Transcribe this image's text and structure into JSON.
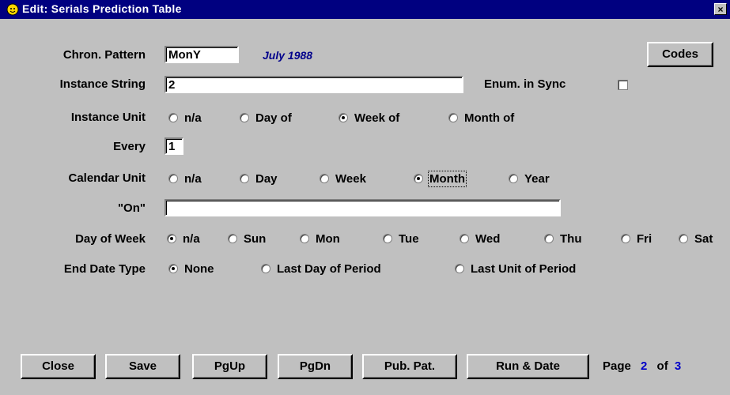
{
  "window": {
    "title": "Edit: Serials Prediction Table",
    "close_glyph": "×"
  },
  "fields": {
    "chron_pattern": {
      "label": "Chron. Pattern",
      "value": "MonY",
      "display": "July 1988"
    },
    "instance_string": {
      "label": "Instance String",
      "value": "2"
    },
    "enum_in_sync": {
      "label": "Enum. in Sync",
      "checked": false
    },
    "every": {
      "label": "Every",
      "value": "1"
    },
    "on": {
      "label": "\"On\"",
      "value": ""
    }
  },
  "instance_unit": {
    "label": "Instance Unit",
    "options": [
      "n/a",
      "Day of",
      "Week of",
      "Month of"
    ],
    "selected": "Week of"
  },
  "calendar_unit": {
    "label": "Calendar Unit",
    "options": [
      "n/a",
      "Day",
      "Week",
      "Month",
      "Year"
    ],
    "selected": "Month"
  },
  "day_of_week": {
    "label": "Day of Week",
    "options": [
      "n/a",
      "Sun",
      "Mon",
      "Tue",
      "Wed",
      "Thu",
      "Fri",
      "Sat"
    ],
    "selected": "n/a"
  },
  "end_date_type": {
    "label": "End Date Type",
    "options": [
      "None",
      "Last Day of Period",
      "Last Unit of Period"
    ],
    "selected": "None"
  },
  "buttons": {
    "codes": "Codes",
    "close": "Close",
    "save": "Save",
    "pgup": "PgUp",
    "pgdn": "PgDn",
    "pub_pat": "Pub. Pat.",
    "run_date": "Run & Date"
  },
  "pagination": {
    "label": "Page",
    "current": "2",
    "of_label": "of",
    "total": "3"
  },
  "colors": {
    "titlebar": "#000080",
    "face": "#c0c0c0",
    "accent": "#0000c8",
    "date_text": "#00008b"
  },
  "icons": {
    "app": "app-icon",
    "close": "close-icon"
  }
}
